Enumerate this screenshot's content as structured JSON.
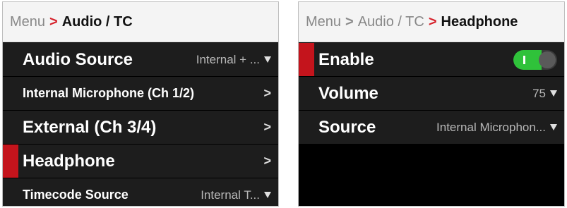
{
  "left": {
    "breadcrumb": {
      "menu": "Menu",
      "current": "Audio / TC"
    },
    "rows": [
      {
        "label": "Audio Source",
        "value": "Internal + ..."
      },
      {
        "label": "Internal Microphone (Ch 1/2)"
      },
      {
        "label": "External (Ch 3/4)"
      },
      {
        "label": "Headphone"
      },
      {
        "label": "Timecode Source",
        "value": "Internal T..."
      }
    ]
  },
  "right": {
    "breadcrumb": {
      "menu": "Menu",
      "parent": "Audio / TC",
      "current": "Headphone"
    },
    "rows": [
      {
        "label": "Enable",
        "toggle_state": "on"
      },
      {
        "label": "Volume",
        "value": "75"
      },
      {
        "label": "Source",
        "value": "Internal Microphon..."
      }
    ]
  },
  "colors": {
    "accent": "#c4141c",
    "toggle_on": "#2fc23a"
  }
}
